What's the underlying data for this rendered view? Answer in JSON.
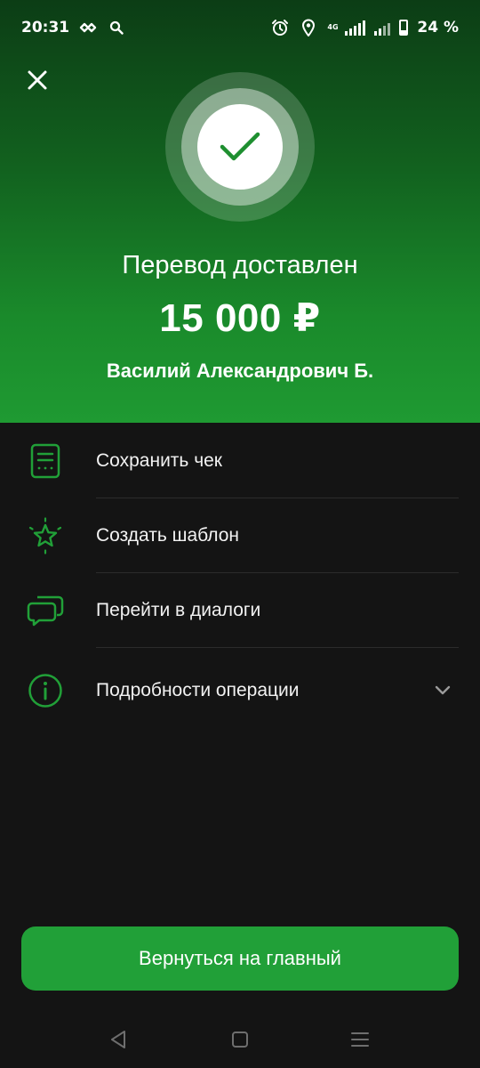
{
  "status_bar": {
    "time": "20:31",
    "network_type": "4G",
    "battery_text": "24 %",
    "icons": [
      "link-icon",
      "search-icon",
      "alarm-icon",
      "location-icon",
      "signal-icon",
      "battery-icon"
    ]
  },
  "header": {
    "close_icon": "close-icon",
    "status_icon": "checkmark-icon",
    "title": "Перевод доставлен",
    "amount": "15 000 ₽",
    "recipient": "Василий Александрович Б."
  },
  "actions": [
    {
      "label": "Сохранить чек",
      "icon": "receipt-icon"
    },
    {
      "label": "Создать шаблон",
      "icon": "star-icon"
    },
    {
      "label": "Перейти в диалоги",
      "icon": "chat-icon"
    },
    {
      "label": "Подробности операции",
      "icon": "info-icon",
      "expandable": true
    }
  ],
  "footer": {
    "home_button_label": "Вернуться на главный"
  },
  "system_nav": [
    "back-icon",
    "home-icon",
    "recents-icon"
  ],
  "colors": {
    "accent": "#21a038",
    "icon_green": "#21a038",
    "background": "#141414",
    "header_top": "#0c3d15",
    "header_bottom": "#1f9a32"
  }
}
